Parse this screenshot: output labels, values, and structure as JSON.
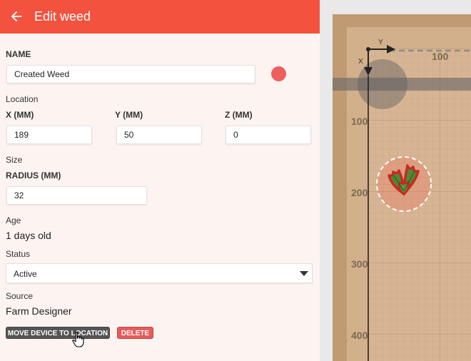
{
  "header": {
    "title": "Edit weed",
    "back_icon": "arrow-left-icon",
    "color": "#f2523e"
  },
  "form": {
    "name_label": "NAME",
    "name_value": "Created Weed",
    "color_dot": "#ee5e5e",
    "location_section": "Location",
    "x_label": "X (MM)",
    "x_value": "189",
    "y_label": "Y (MM)",
    "y_value": "50",
    "z_label": "Z (MM)",
    "z_value": "0",
    "size_section": "Size",
    "radius_label": "RADIUS (MM)",
    "radius_value": "32",
    "age_section": "Age",
    "age_value": "1 days old",
    "status_section": "Status",
    "status_value": "Active",
    "source_section": "Source",
    "source_value": "Farm Designer",
    "move_button": "MOVE DEVICE TO LOCATION",
    "delete_button": "DELETE"
  },
  "map": {
    "x_axis_letter": "X",
    "y_axis_letter": "Y",
    "top_tick": "100",
    "left_ticks": [
      "100",
      "200",
      "300",
      "400"
    ],
    "weed_icon": "holly-leaf-icon",
    "soil_color": "#d7b594",
    "border_color": "#c09a72"
  }
}
